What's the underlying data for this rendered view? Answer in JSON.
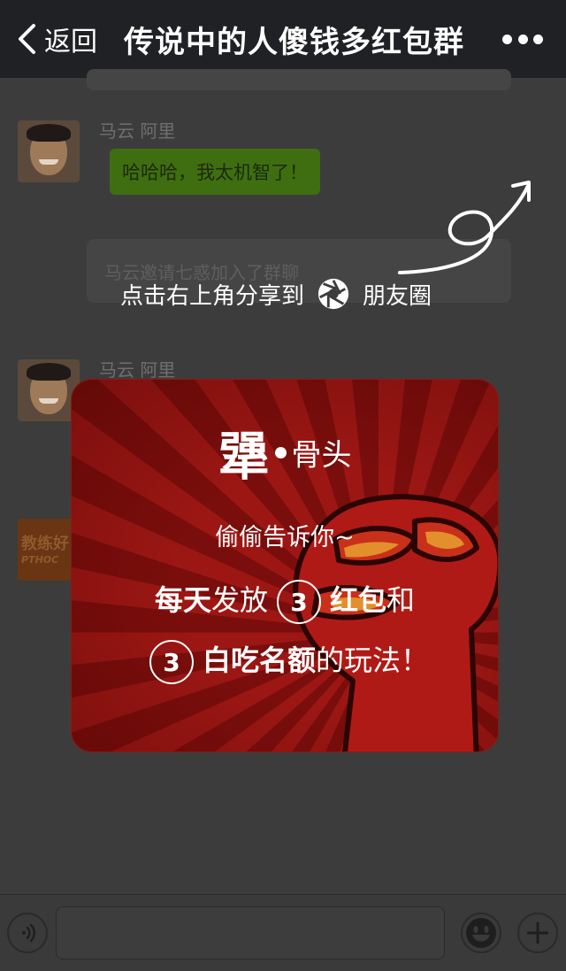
{
  "header": {
    "back_label": "返回",
    "title": "传说中的人傻钱多红包群",
    "more_icon": "more-dots-icon"
  },
  "chat": {
    "messages": [
      {
        "sender": "马云 阿里",
        "text": "哈哈哈，我太机智了！"
      },
      {
        "system": "马云邀请七惑加入了群聊"
      },
      {
        "sender": "马云 阿里"
      }
    ],
    "thumb_line1": "教练好",
    "thumb_line2": "PTHOC"
  },
  "share_hint": {
    "left": "点击右上角分享到",
    "right": "朋友圈"
  },
  "popup": {
    "logo_big": "犟",
    "logo_small": "骨头",
    "hint": "偷偷告诉你~",
    "line1_bold": "每天",
    "line1_text": "发放",
    "line1_num": "3",
    "line1_bold2": "红包",
    "line1_end": "和",
    "line2_num": "3",
    "line2_bold": "白吃名额",
    "line2_end": "的玩法！"
  },
  "input": {
    "placeholder": ""
  },
  "colors": {
    "nav_bg": "#1f2124",
    "popup_red": "#9c1714",
    "bubble_green": "#3f6e10"
  }
}
